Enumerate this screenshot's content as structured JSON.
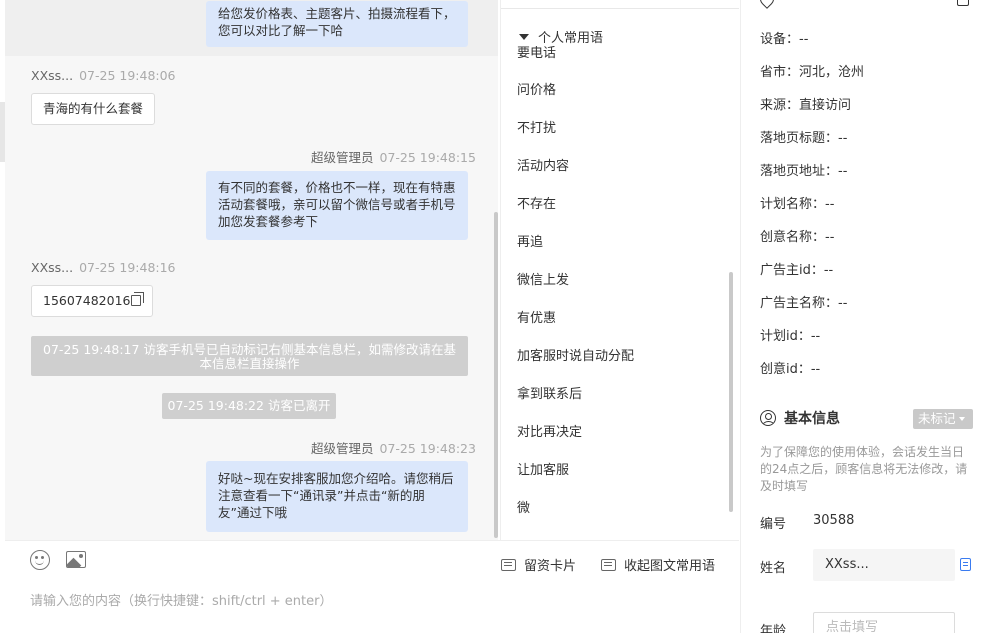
{
  "chat": {
    "msg1_text": "给您发价格表、主题客片、拍摄流程看下，您可以对比了解一下哈",
    "visitor_name": "XXss...",
    "agent_name": "超级管理员",
    "msg2_time": "07-25 19:48:06",
    "msg2_text": "青海的有什么套餐",
    "msg3_time": "07-25 19:48:15",
    "msg3_text": "有不同的套餐，价格也不一样，现在有特惠活动套餐哦，亲可以留个微信号或者手机号 加您发套餐参考下",
    "msg4_time": "07-25 19:48:16",
    "msg4_text": "15607482016",
    "sys1": "07-25 19:48:17 访客手机号已自动标记右侧基本信息栏，如需修改请在基本信息栏直接操作",
    "sys2": "07-25 19:48:22 访客已离开",
    "msg5_time": "07-25 19:48:23",
    "msg5_text": "好哒~现在安排客服加您介绍哈。请您稍后注意查看一下“通讯录”并点击“新的朋友”通过下哦"
  },
  "phrases": {
    "group_title": "个人常用语",
    "items": [
      "要电话",
      "问价格",
      "不打扰",
      "活动内容",
      "不存在",
      "再追",
      "微信上发",
      "有优惠",
      "加客服时说自动分配",
      "拿到联系后",
      "对比再决定",
      "让加客服",
      "微"
    ]
  },
  "input": {
    "card_button": "留资卡片",
    "collapse_button": "收起图文常用语",
    "placeholder": "请输入您的内容（换行快捷键：shift/ctrl + enter）"
  },
  "info": {
    "source_rows": [
      "设备：--",
      "省市：河北，沧州",
      "来源：直接访问",
      "落地页标题：--",
      "落地页地址：--",
      "计划名称：--",
      "创意名称：--",
      "广告主id：--",
      "广告主名称：--",
      "计划id：--",
      "创意id：--"
    ],
    "basic_title": "基本信息",
    "tag_label": "未标记",
    "hint": "为了保障您的使用体验，会话发生当日的24点之后，顾客信息将无法修改，请及时填写",
    "id_label": "编号",
    "id_value": "30588",
    "name_label": "姓名",
    "name_value": "XXss...",
    "age_label": "年龄",
    "age_placeholder": "点击填写"
  }
}
